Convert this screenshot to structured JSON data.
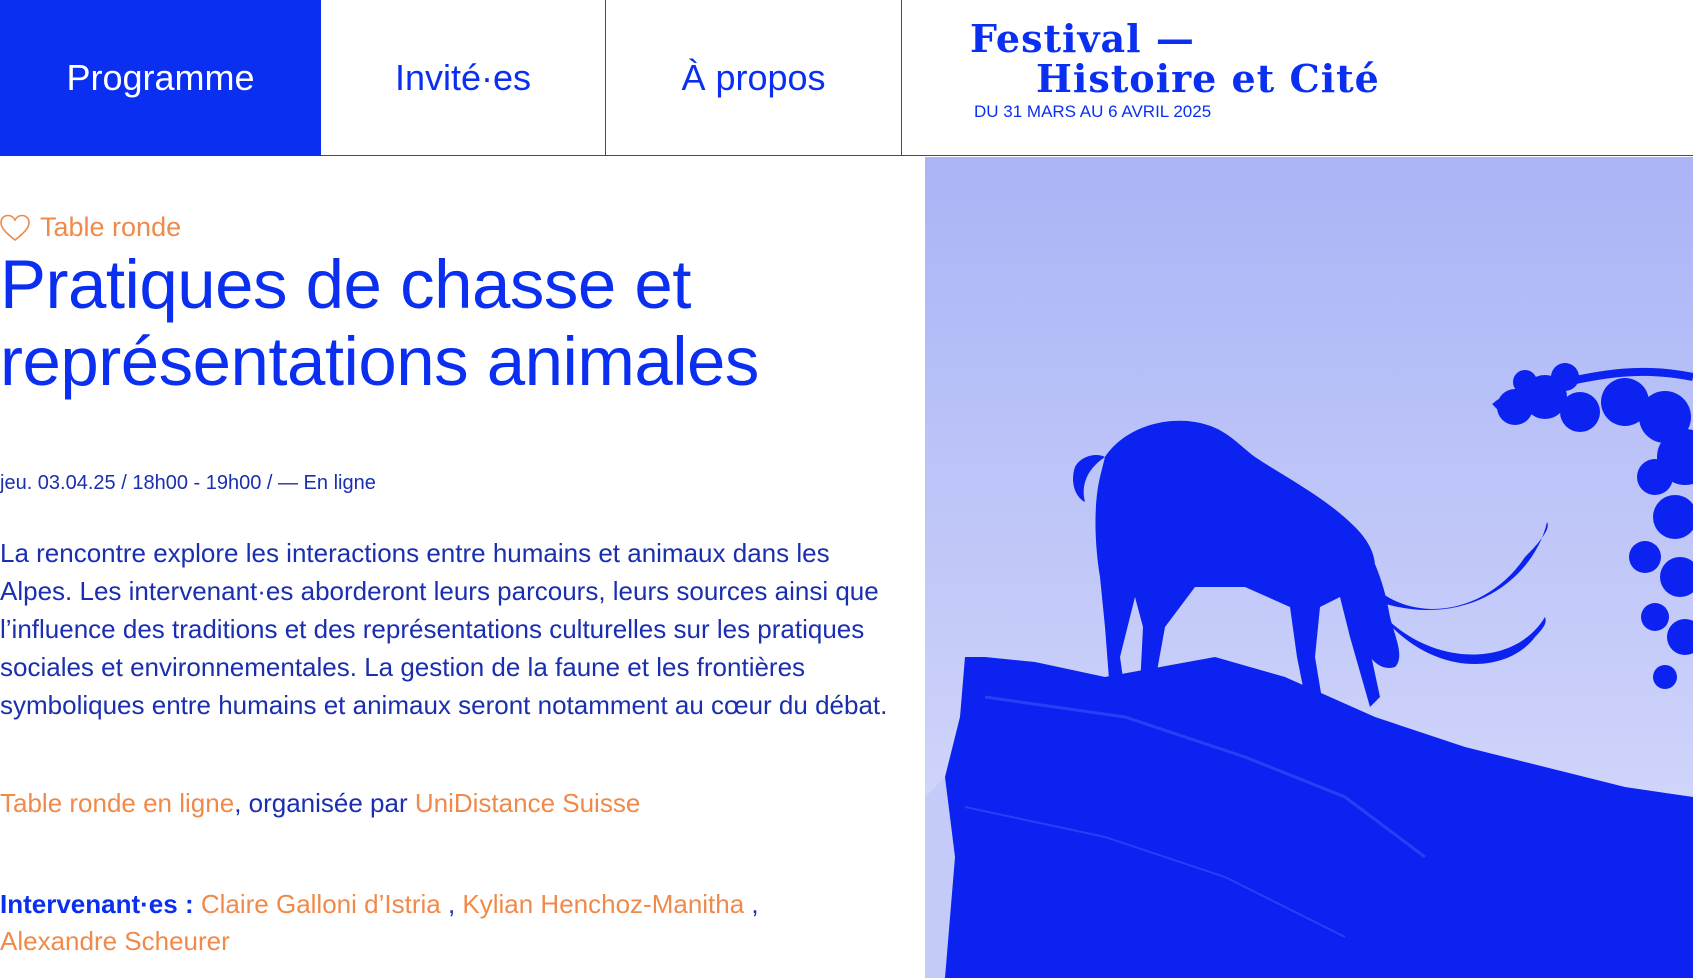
{
  "nav": {
    "programme": "Programme",
    "invites": "Invité·es",
    "apropos": "À propos"
  },
  "festival": {
    "line1": "Festival —",
    "line2": "Histoire et Cité",
    "dates": "DU 31 MARS AU 6 AVRIL 2025"
  },
  "event": {
    "category": "Table ronde",
    "title": "Pratiques de chasse et représentations animales",
    "meta": "jeu. 03.04.25 / 18h00 - 19h00 / — En ligne",
    "description": "La rencontre explore les interactions entre humains et animaux dans les Alpes. Les intervenant·es aborderont leurs parcours, leurs sources ainsi que l’influence des traditions et des représentations culturelles sur les pratiques sociales et environnementales. La gestion de la faune et les frontières symboliques entre humains et animaux seront notamment au cœur du débat.",
    "format_link": "Table ronde en ligne",
    "organized_by": ", organisée par ",
    "organizer_link": "UniDistance Suisse",
    "speakers_label": "Intervenant·es :",
    "speakers": [
      "Claire Galloni d’Istria",
      "Kylian Henchoz-Manitha",
      "Alexandre Scheurer"
    ],
    "speaker_sep": " , "
  },
  "colors": {
    "brand_blue": "#0a2ff0",
    "accent_orange": "#f08a4b",
    "text_blue": "#1a2fb0"
  },
  "icons": {
    "favorite": "heart-outline-icon"
  }
}
